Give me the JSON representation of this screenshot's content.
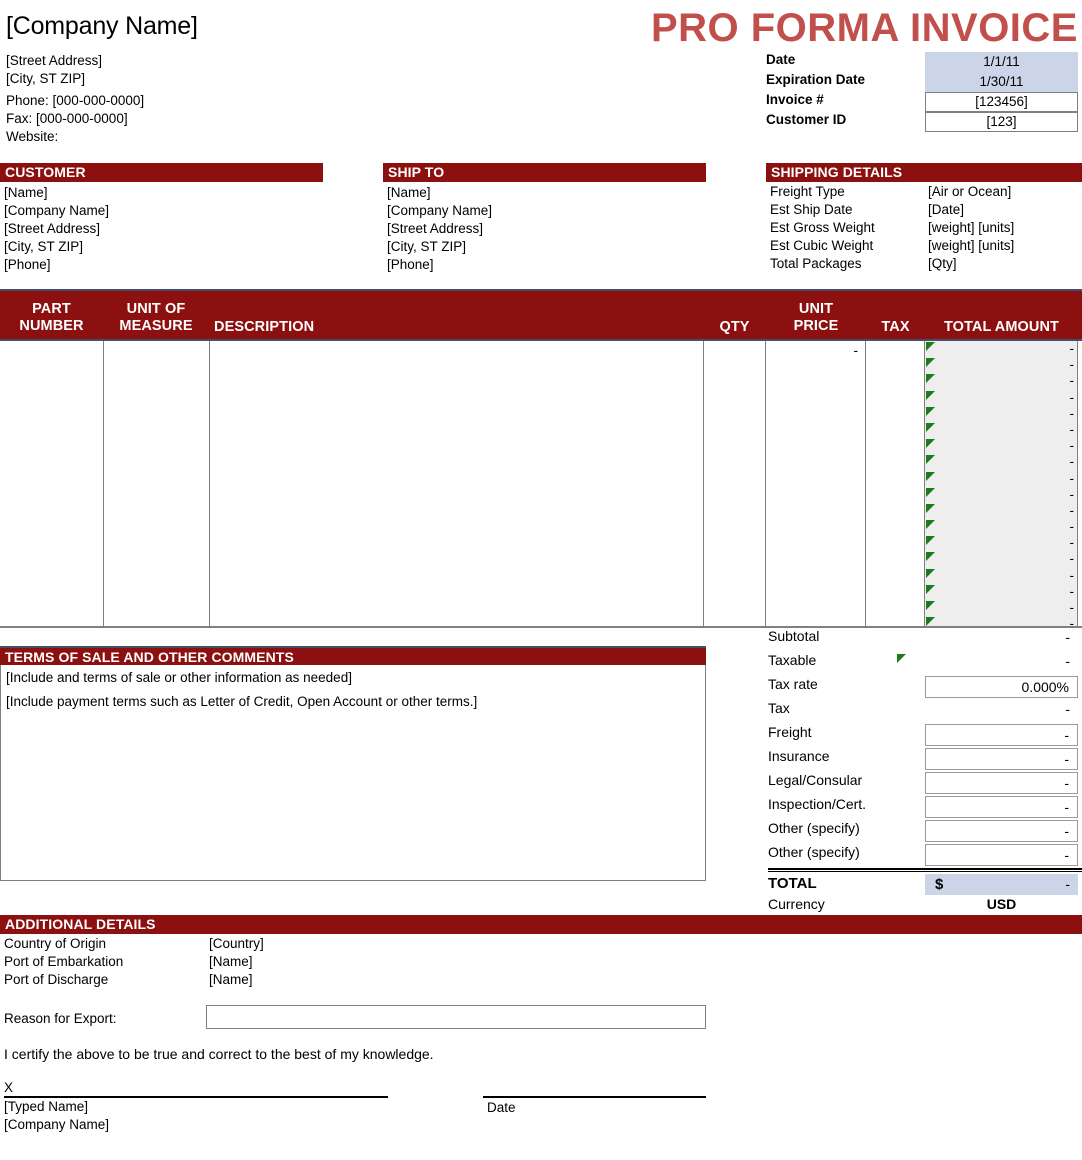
{
  "colors": {
    "header_red": "#8c1010",
    "title_red": "#c1504d",
    "shaded_blue": "#ccd5e8",
    "total_col_bg": "#eeeeee",
    "flag_green": "#1d7a1d",
    "rule_navy": "#44506b"
  },
  "company": {
    "name": "[Company Name]",
    "street": "[Street Address]",
    "city": "[City, ST  ZIP]",
    "phone": "Phone: [000-000-0000]",
    "fax": "Fax: [000-000-0000]",
    "website": "Website:"
  },
  "title": "PRO FORMA INVOICE",
  "meta": [
    {
      "label": "Date",
      "value": "1/1/11",
      "style": "shaded"
    },
    {
      "label": "Expiration Date",
      "value": "1/30/11",
      "style": "shaded"
    },
    {
      "label": "Invoice #",
      "value": "[123456]",
      "style": "boxed"
    },
    {
      "label": "Customer ID",
      "value": "[123]",
      "style": "boxed"
    }
  ],
  "customer": {
    "heading": "CUSTOMER",
    "lines": [
      "[Name]",
      "[Company Name]",
      "[Street Address]",
      "[City, ST  ZIP]",
      "[Phone]"
    ]
  },
  "ship_to": {
    "heading": "SHIP TO",
    "lines": [
      "[Name]",
      "[Company Name]",
      "[Street Address]",
      "[City, ST  ZIP]",
      "[Phone]"
    ]
  },
  "shipping_details": {
    "heading": "SHIPPING DETAILS",
    "rows": [
      {
        "label": "Freight Type",
        "value": "[Air or Ocean]"
      },
      {
        "label": "Est Ship Date",
        "value": "[Date]"
      },
      {
        "label": "Est Gross Weight",
        "value": "[weight] [units]"
      },
      {
        "label": "Est Cubic Weight",
        "value": "[weight] [units]"
      },
      {
        "label": "Total Packages",
        "value": "[Qty]"
      }
    ]
  },
  "items_table": {
    "headers": {
      "part_number_l1": "PART",
      "part_number_l2": "NUMBER",
      "unit_of_measure_l1": "UNIT OF",
      "unit_of_measure_l2": "MEASURE",
      "description": "DESCRIPTION",
      "qty": "QTY",
      "unit_price_l1": "UNIT",
      "unit_price_l2": "PRICE",
      "tax": "TAX",
      "total_amount": "TOTAL AMOUNT"
    },
    "first_row_unit_price": "-",
    "row_count": 18,
    "row_amount": "-"
  },
  "terms": {
    "heading": "TERMS OF SALE AND OTHER COMMENTS",
    "line1": "[Include and terms of sale or other information as needed]",
    "line2": "[Include payment terms such as Letter of Credit, Open Account or other terms.]"
  },
  "totals": {
    "rows": [
      {
        "label": "Subtotal",
        "value": "-",
        "boxed": false,
        "flag": false
      },
      {
        "label": "Taxable",
        "value": "-",
        "boxed": false,
        "flag": true
      },
      {
        "label": "Tax rate",
        "value": "0.000%",
        "boxed": true,
        "flag": false
      },
      {
        "label": "Tax",
        "value": "-",
        "boxed": false,
        "flag": false
      },
      {
        "label": "Freight",
        "value": "-",
        "boxed": true,
        "flag": false
      },
      {
        "label": "Insurance",
        "value": "-",
        "boxed": true,
        "flag": false
      },
      {
        "label": "Legal/Consular",
        "value": "-",
        "boxed": true,
        "flag": false
      },
      {
        "label": "Inspection/Cert.",
        "value": "-",
        "boxed": true,
        "flag": false
      },
      {
        "label": "Other (specify)",
        "value": "-",
        "boxed": true,
        "flag": false
      },
      {
        "label": "Other (specify)",
        "value": "-",
        "boxed": true,
        "flag": false
      }
    ],
    "total_label": "TOTAL",
    "total_symbol": "$",
    "total_value": "-",
    "currency_label": "Currency",
    "currency_value": "USD"
  },
  "additional_details": {
    "heading": "ADDITIONAL DETAILS",
    "rows": [
      {
        "label": "Country of Origin",
        "value": "[Country]"
      },
      {
        "label": "Port of Embarkation",
        "value": "[Name]"
      },
      {
        "label": "Port of Discharge",
        "value": "[Name]"
      }
    ],
    "reason_label": "Reason for Export:",
    "reason_value": ""
  },
  "signature": {
    "certify": "I certify the above to be true and correct to the best of my knowledge.",
    "x_mark": "X",
    "typed_name": "[Typed Name]",
    "company_name": "[Company Name]",
    "date_label": "Date"
  }
}
